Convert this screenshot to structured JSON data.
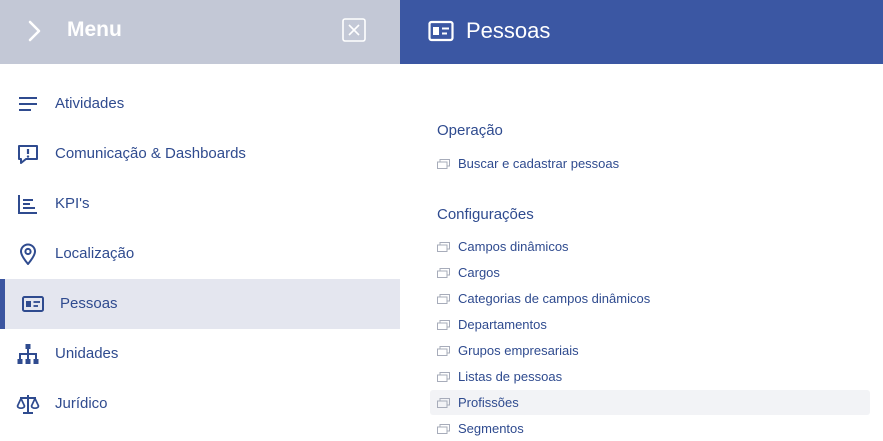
{
  "menu": {
    "title": "Menu",
    "items": [
      {
        "label": "Atividades",
        "icon": "list-icon"
      },
      {
        "label": "Comunicação & Dashboards",
        "icon": "chat-alert-icon"
      },
      {
        "label": "KPI's",
        "icon": "bar-chart-icon"
      },
      {
        "label": "Localização",
        "icon": "map-pin-icon"
      },
      {
        "label": "Pessoas",
        "icon": "id-card-icon",
        "active": true
      },
      {
        "label": "Unidades",
        "icon": "org-chart-icon"
      },
      {
        "label": "Jurídico",
        "icon": "scales-icon"
      }
    ]
  },
  "panel": {
    "title": "Pessoas",
    "icon": "id-card-icon",
    "sections": [
      {
        "title": "Operação",
        "links": [
          "Buscar e cadastrar pessoas"
        ]
      },
      {
        "title": "Configurações",
        "links": [
          "Campos dinâmicos",
          "Cargos",
          "Categorias de campos dinâmicos",
          "Departamentos",
          "Grupos empresariais",
          "Listas de pessoas",
          "Profissões",
          "Segmentos"
        ]
      }
    ],
    "hovered_link": "Profissões"
  },
  "colors": {
    "menu_header": "#c3c8d6",
    "panel_header": "#3b57a3",
    "text": "#2f4b8f",
    "active_bg": "#e4e6ef",
    "active_bar": "#3b55a0"
  }
}
